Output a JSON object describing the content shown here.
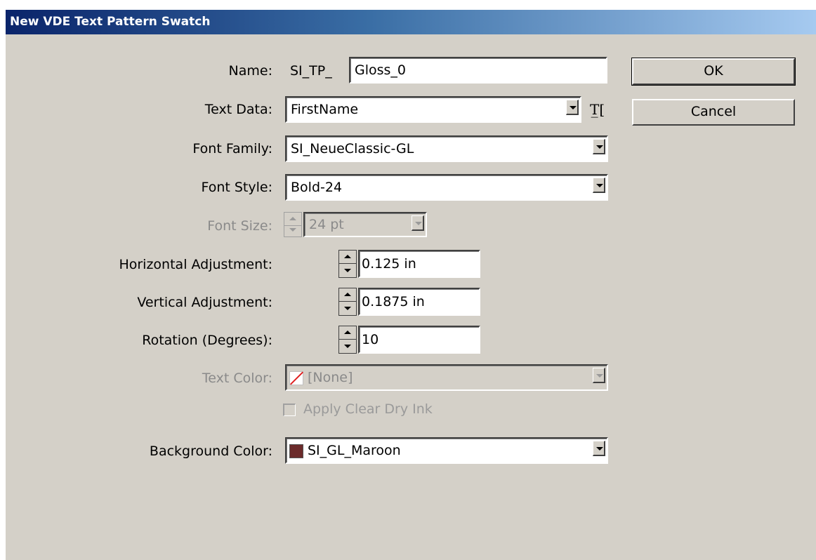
{
  "window": {
    "title": "New VDE Text Pattern Swatch"
  },
  "name": {
    "label": "Name:",
    "prefix": "SI_TP_",
    "value": "Gloss_0"
  },
  "text_data": {
    "label": "Text Data:",
    "value": "FirstName",
    "icon": "text-insert-icon"
  },
  "font_family": {
    "label": "Font Family:",
    "value": "SI_NeueClassic-GL"
  },
  "font_style": {
    "label": "Font Style:",
    "value": "Bold-24"
  },
  "font_size": {
    "label": "Font Size:",
    "value": "24 pt",
    "enabled": false
  },
  "horizontal_adjustment": {
    "label": "Horizontal Adjustment:",
    "value": "0.125 in"
  },
  "vertical_adjustment": {
    "label": "Vertical Adjustment:",
    "value": "0.1875 in"
  },
  "rotation": {
    "label": "Rotation (Degrees):",
    "value": "10"
  },
  "text_color": {
    "label": "Text Color:",
    "value": "[None]",
    "enabled": false
  },
  "apply_clear_dry_ink": {
    "label": "Apply Clear Dry Ink",
    "checked": false,
    "enabled": false
  },
  "background_color": {
    "label": "Background Color:",
    "value": "SI_GL_Maroon",
    "swatch": "#6b2a2a"
  },
  "buttons": {
    "ok": "OK",
    "cancel": "Cancel"
  }
}
